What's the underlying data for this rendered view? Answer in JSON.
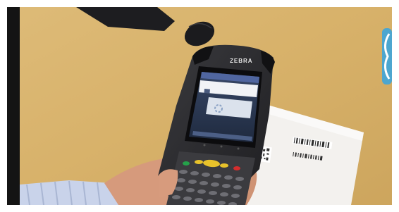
{
  "image": {
    "description_labels": {
      "device_brand": "ZEBRA",
      "status_bar": "",
      "screen_title": "",
      "screen_message": "",
      "dialog_text": "",
      "screen_button": "",
      "document_text": ""
    }
  },
  "colors": {
    "frame": "#ffffff",
    "letterbox": "#141414",
    "desk": "#d9b56e",
    "device_body": "#2a2a2d",
    "screen_bg": "#2b3850",
    "dialog_bg": "#d7dee8",
    "keypad_yellow": "#e8c22b",
    "keypad_green": "#25a14a",
    "keypad_red": "#d52d2d",
    "side_tab": "#4da6cf"
  }
}
